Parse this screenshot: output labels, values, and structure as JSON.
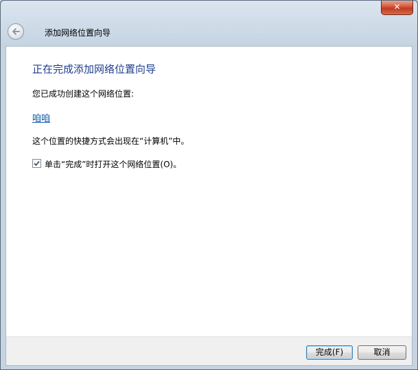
{
  "window": {
    "close_glyph": "✕"
  },
  "wizard": {
    "title": "添加网络位置向导"
  },
  "content": {
    "heading": "正在完成添加网络位置向导",
    "description": "您已成功创建这个网络位置:",
    "location_link": "咱咱",
    "shortcut_note": "这个位置的快捷方式会出现在“计算机”中。",
    "checkbox_label": "单击“完成”时打开这个网络位置(O)。",
    "checkbox_checked": true
  },
  "footer": {
    "finish_label": "完成(F)",
    "cancel_label": "取消"
  }
}
